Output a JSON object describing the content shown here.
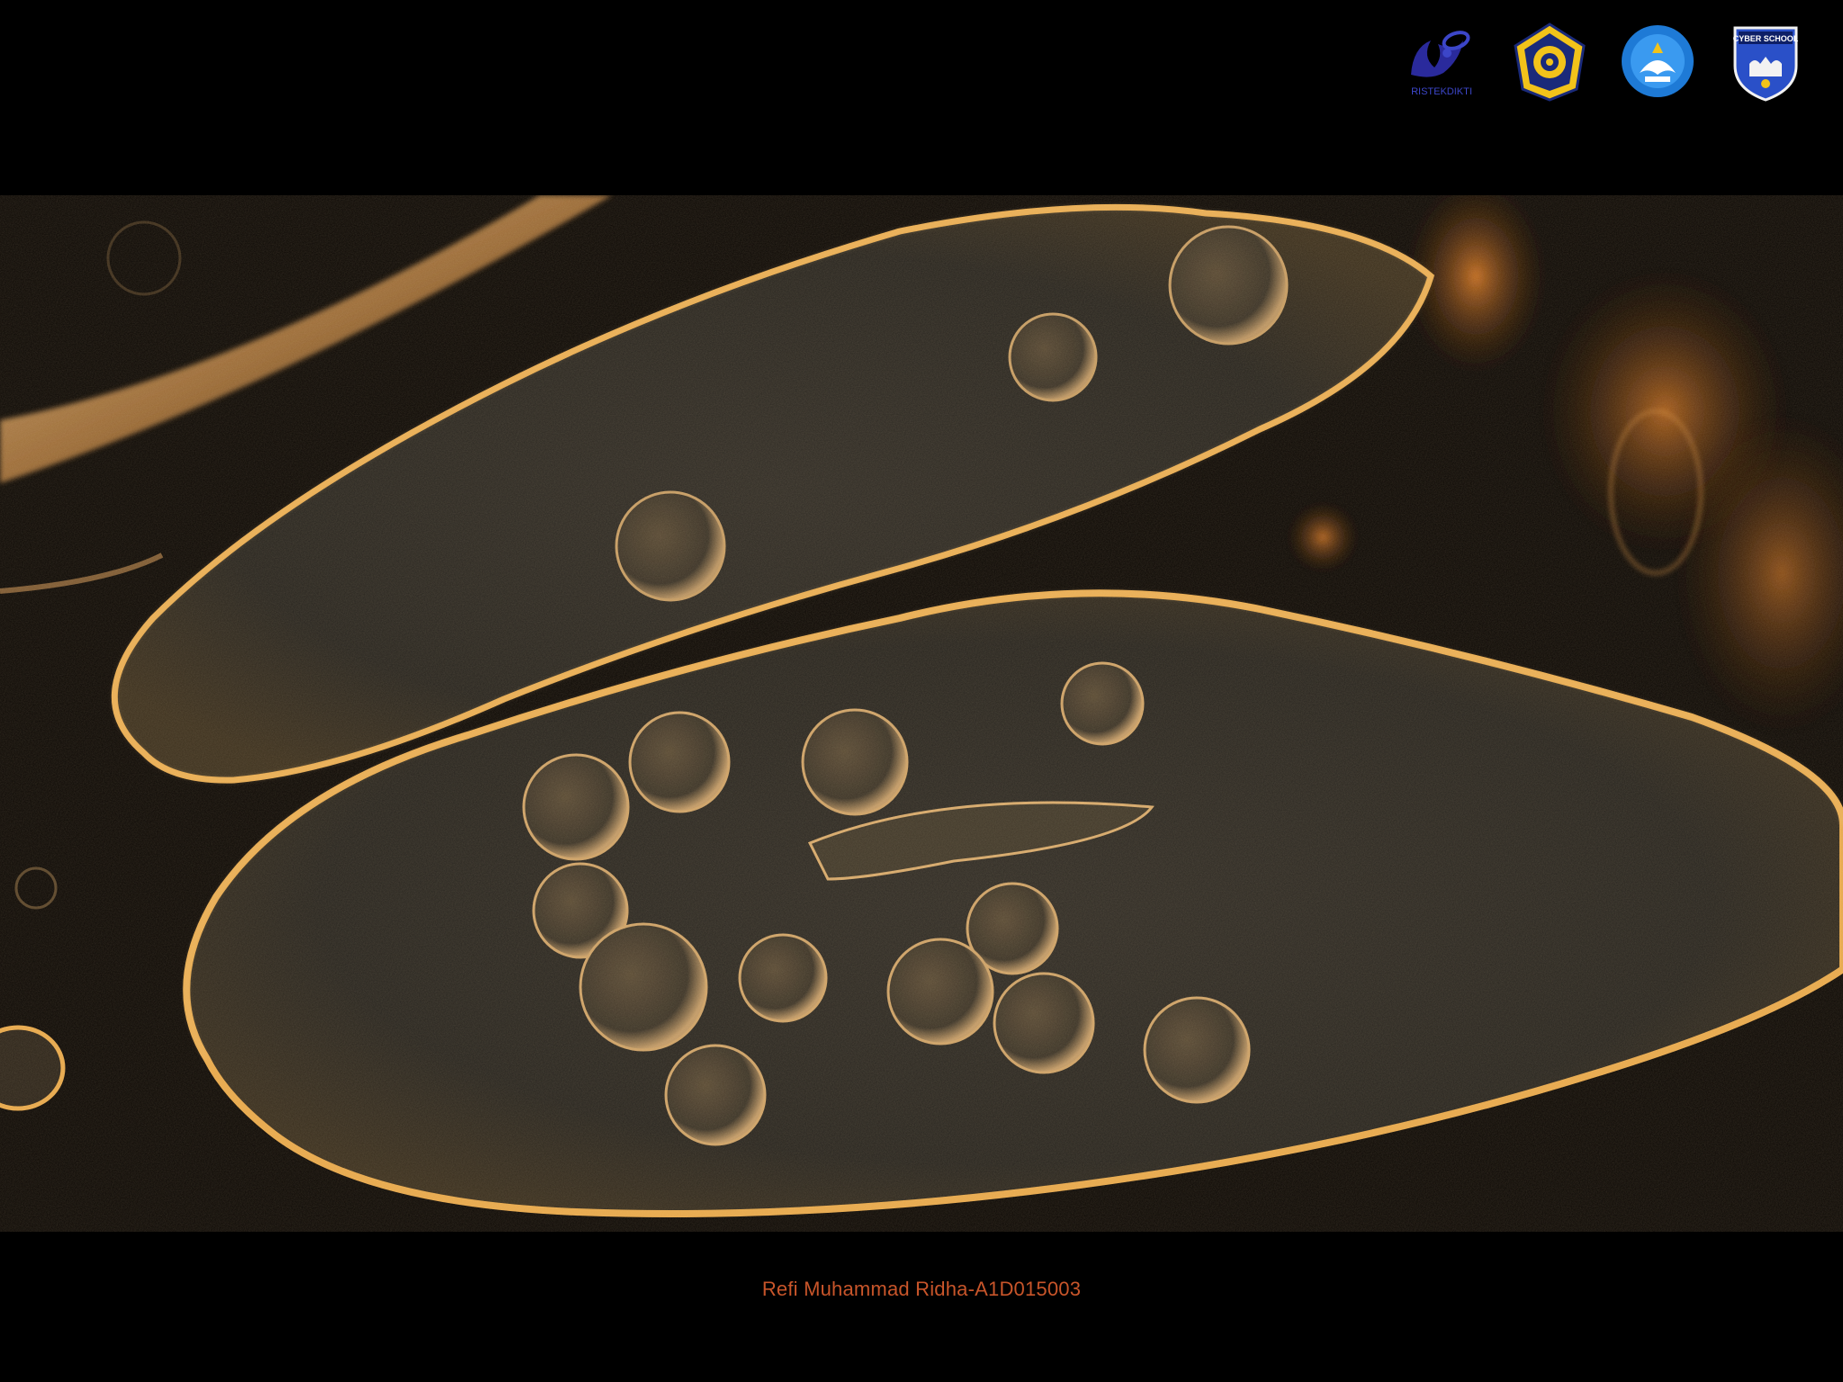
{
  "header": {
    "logos": [
      {
        "icon": "ristekdikti-logo",
        "text": "RISTEKDIKTI"
      },
      {
        "icon": "university-seal-logo"
      },
      {
        "icon": "tut-wuri-handayani-logo"
      },
      {
        "icon": "cyber-school-logo",
        "text": "CYBER SCHOOL"
      }
    ]
  },
  "photo": {
    "subject": "paramecium-micrograph"
  },
  "footer": {
    "author": "Refi Muhammad Ridha-A1D015003"
  },
  "colors": {
    "background": "#000000",
    "footer_text": "#c8552a",
    "cell_edge": "#e8a84a"
  }
}
